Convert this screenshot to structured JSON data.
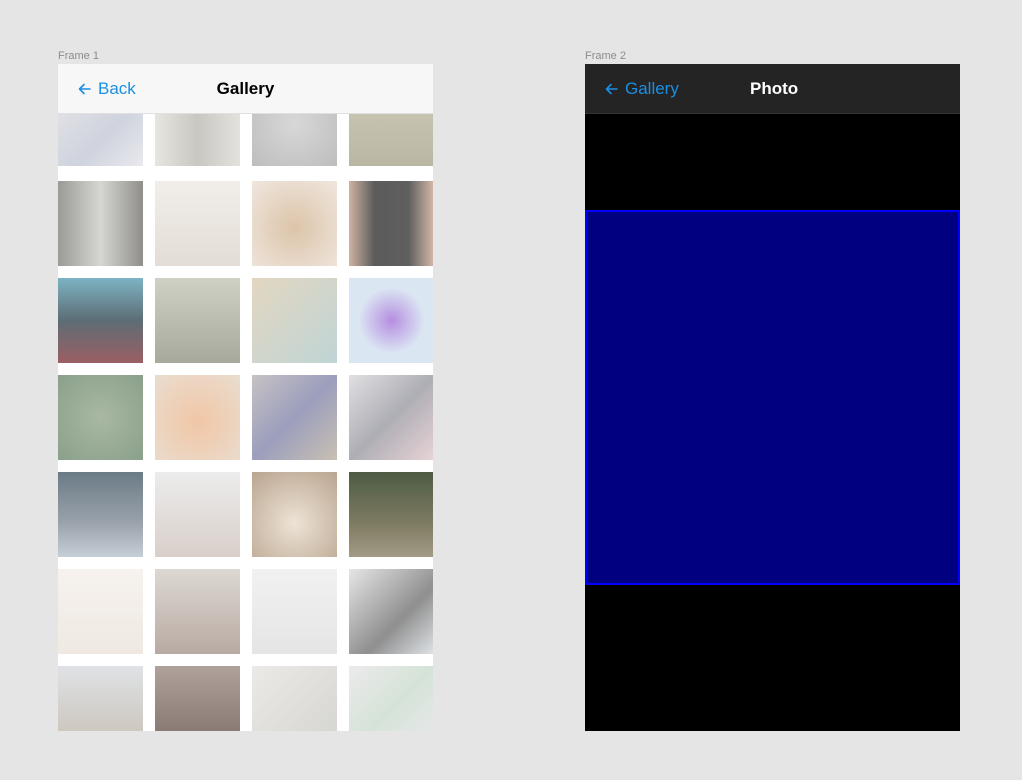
{
  "frames": [
    {
      "label": "Frame 1",
      "back_label": "Back",
      "title": "Gallery"
    },
    {
      "label": "Frame 2",
      "back_label": "Gallery",
      "title": "Photo"
    }
  ],
  "colors": {
    "accent": "#1a8fe3",
    "photo_fill": "#000080",
    "photo_border": "#0000ff"
  },
  "gallery": {
    "thumbnails": [
      {
        "name": "sign-holders",
        "bg": "linear-gradient(135deg,#e8e6e8,#cfd3dd 60%,#e9e9ee)"
      },
      {
        "name": "building-facade",
        "bg": "linear-gradient(90deg,#e7e5e0,#c9c7c2 50%,#e3e2de)"
      },
      {
        "name": "foliage-gray",
        "bg": "radial-gradient(circle,#d8d8d8,#bdbdbd)"
      },
      {
        "name": "forest",
        "bg": "linear-gradient(180deg,#cfcab9,#b9b7a3)"
      },
      {
        "name": "street-alley",
        "bg": "linear-gradient(90deg,#9a9a96,#d6d6d3 50%,#8f8e8a)"
      },
      {
        "name": "bedroom",
        "bg": "linear-gradient(180deg,#f1eeea,#e3ddd5)"
      },
      {
        "name": "bread",
        "bg": "radial-gradient(circle at 50% 55%,#dcc4a9,#f0e7df)"
      },
      {
        "name": "menu-board",
        "bg": "linear-gradient(90deg,#cfb2a3,#5b5b5b 30%,#5f5f5f 70%,#d6b9aa)"
      },
      {
        "name": "neon-street",
        "bg": "linear-gradient(180deg,#7db3c4,#5d6d74 50%,#9a5f64)"
      },
      {
        "name": "girl-bags",
        "bg": "linear-gradient(180deg,#cfd1c4,#a7a99d)"
      },
      {
        "name": "girl-writing",
        "bg": "linear-gradient(135deg,#e3d6c1,#bfd5d5)"
      },
      {
        "name": "purple-cube",
        "bg": "radial-gradient(circle,#b58ee0,#dbe6f3 55%)"
      },
      {
        "name": "green-leaves",
        "bg": "radial-gradient(circle,#a9b8a3,#8aa08a)"
      },
      {
        "name": "warm-bokeh",
        "bg": "radial-gradient(circle at 50% 55%,#f1c7a6,#e9ddd0)"
      },
      {
        "name": "magazine-reader",
        "bg": "linear-gradient(135deg,#c7c2c4,#9b9ebd 50%,#c9c0b3)"
      },
      {
        "name": "headphones",
        "bg": "linear-gradient(135deg,#e0e0e3,#aeaeb5 50%,#e7d3d6)"
      },
      {
        "name": "city-night",
        "bg": "linear-gradient(180deg,#6b7b86,#9aa2ab 60%,#c6cfd6)"
      },
      {
        "name": "couple-walk",
        "bg": "linear-gradient(180deg,#ececec,#d9cfca)"
      },
      {
        "name": "stone-arch",
        "bg": "radial-gradient(circle at 50% 60%,#ede3d5,#b9a48f)"
      },
      {
        "name": "bicycle",
        "bg": "linear-gradient(180deg,#4e5b44,#7d7b61 60%,#a29b86)"
      },
      {
        "name": "white-pillow",
        "bg": "linear-gradient(180deg,#f6f2ee,#efe9e2)"
      },
      {
        "name": "street-walker",
        "bg": "linear-gradient(180deg,#ddd8d3,#b8aaa2)"
      },
      {
        "name": "clothing-rack",
        "bg": "linear-gradient(180deg,#f1f1f1,#e5e5e5)"
      },
      {
        "name": "person-laptop",
        "bg": "linear-gradient(135deg,#e6e6e6,#8f8f8f 60%,#dfe3e6)"
      },
      {
        "name": "spanish-steps",
        "bg": "linear-gradient(180deg,#dfe2e6,#c8c0b4)"
      },
      {
        "name": "dark-street",
        "bg": "linear-gradient(180deg,#b1a19b,#7e6f6a)"
      },
      {
        "name": "building-white",
        "bg": "linear-gradient(135deg,#eceae7,#d3d3cf)"
      },
      {
        "name": "sign-holders-2",
        "bg": "linear-gradient(135deg,#eceaec,#d5e3d7 50%,#e9e9ee)"
      }
    ]
  }
}
